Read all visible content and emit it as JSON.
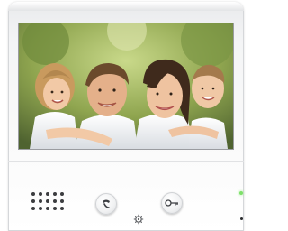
{
  "device": {
    "screen": {
      "content": "family photo"
    },
    "buttons": [
      {
        "icon": "talk-icon",
        "caption": "",
        "interactable": true
      },
      {
        "icon": "key-icon",
        "caption": "",
        "interactable": true
      }
    ],
    "settings_icon": "gear-icon",
    "status_leds": [
      {
        "name": "power-led",
        "color": "#7ee06a"
      },
      {
        "name": "indicator-led",
        "color": "#2b2c2e"
      }
    ]
  },
  "colors": {
    "body": "#f4f5f6",
    "screen_bezel": "#9a9ca0",
    "speaker_holes": "#3c3d40"
  }
}
